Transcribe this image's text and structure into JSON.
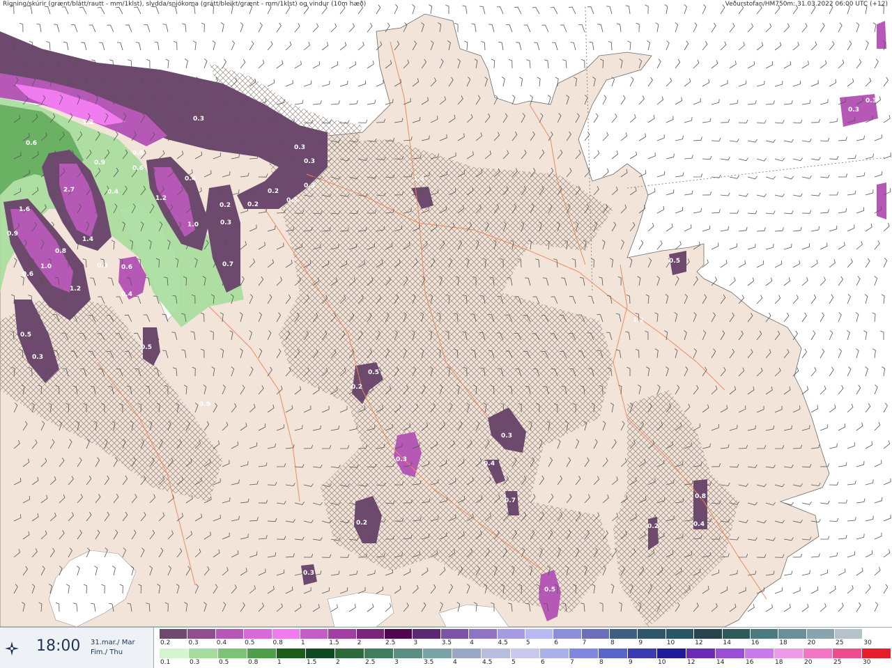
{
  "header": {
    "left_caption": "Rigning/skúrir (grænt/blátt/rautt - mm/1klst), slydda/snjókoma (grátt/bleikt/grænt - mm/1klst) og vindur (10m hæð)",
    "right_caption": "Veðurstofan/HM750m: 31.03.2022 06:00 UTC (+12)"
  },
  "footer": {
    "time": "18:00",
    "date_is": "31.mar./ Mar",
    "day_is": "Fim./ Thu",
    "icon": "compass-star-icon"
  },
  "legend_snow": {
    "labels": [
      "0.2",
      "0.3",
      "0.4",
      "0.5",
      "0.8",
      "1",
      "1.5",
      "2",
      "2.5",
      "3",
      "3.5",
      "4",
      "4.5",
      "5",
      "6",
      "7",
      "8",
      "9",
      "10",
      "12",
      "14",
      "16",
      "18",
      "20",
      "25",
      "30"
    ],
    "colors": [
      "#6d4a6d",
      "#8e4f8e",
      "#b658b6",
      "#d86ad8",
      "#f07cf0",
      "#c45ec4",
      "#a23fa2",
      "#7a247a",
      "#4f064f",
      "#5b2a73",
      "#7b55a3",
      "#8f74c2",
      "#a59be0",
      "#b9b9f2",
      "#8d8fd6",
      "#6b6fba",
      "#3f5f80",
      "#2f556a",
      "#2a5566",
      "#29434d",
      "#2f5a5a",
      "#4c7a7e",
      "#6a8f96",
      "#8aa4ad",
      "#b4c3c8",
      "#ffffff"
    ]
  },
  "legend_rain": {
    "labels": [
      "0.1",
      "0.3",
      "0.5",
      "0.8",
      "1",
      "1.5",
      "2",
      "2.5",
      "3",
      "3.5",
      "4",
      "4.5",
      "5",
      "6",
      "7",
      "8",
      "9",
      "10",
      "12",
      "14",
      "16",
      "18",
      "20",
      "25",
      "30"
    ],
    "colors": [
      "#d4f5cf",
      "#a6dd9c",
      "#7cc474",
      "#4e9e4a",
      "#1b5e1b",
      "#0e4a22",
      "#2a6a3b",
      "#3f7e5c",
      "#5b8f84",
      "#7aa2a6",
      "#9aa8c8",
      "#b6bde0",
      "#c9c9f0",
      "#aab0ea",
      "#7f87e0",
      "#5865cc",
      "#3a3bb0",
      "#1f1a9a",
      "#6a2bb5",
      "#9a4ed6",
      "#c77be8",
      "#ef9ae8",
      "#f276c4",
      "#ee4c8c",
      "#e61e2a"
    ]
  },
  "map_labels": [
    "0.3",
    "0.3",
    "1.2",
    "0.6",
    "0.6",
    "0.6",
    "2.7",
    "1.4",
    "0.4",
    "1.2",
    "1.6",
    "0.9",
    "0.8",
    "1.0",
    "0.6",
    "1.2",
    "0.4",
    "0.9",
    "1.0",
    "0.3",
    "0.6",
    "0.7",
    "0.5",
    "0.2",
    "0.3",
    "0.3",
    "0.3",
    "0.4",
    "0.2",
    "0.2",
    "0.3",
    "0.5",
    "0.9",
    "0.3",
    "0.3",
    "0.4",
    "0.7",
    "0.2",
    "0.3",
    "0.5",
    "0.4",
    "0.8",
    "0.2",
    "0.5",
    "0.3",
    "0.3",
    "1.3",
    "1.2",
    "0.2",
    "0.3",
    "0.5"
  ]
}
